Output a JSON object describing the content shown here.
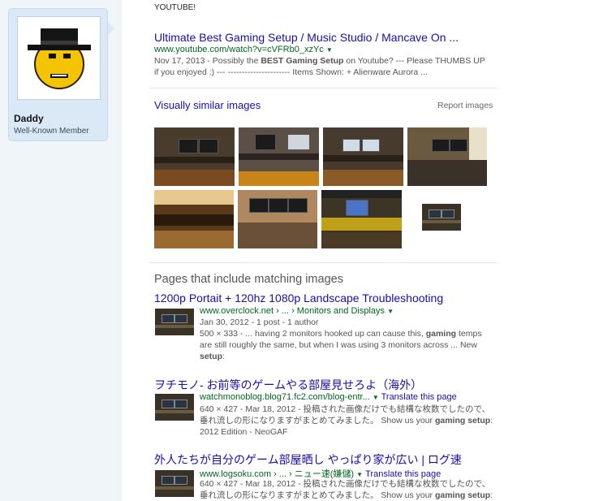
{
  "forum_user": {
    "name": "Daddy",
    "title": "Well-Known Member",
    "avatar": "smiley-fedora-avatar"
  },
  "results": {
    "clipped_top": "YOUTUBE!",
    "first": {
      "title": "Ultimate Best Gaming Setup / Music Studio / Mancave On ...",
      "url": "www.youtube.com/watch?v=cVFRb0_xzYc",
      "date": "Nov 17, 2013",
      "snippet_l1_a": " - Possibly the ",
      "snippet_l1_b": "BEST Gaming Setup",
      "snippet_l1_c": " on Youtube? --- Please THUMBS UP",
      "snippet_l2": "if you enjoyed :) --- ---------------------- Items Shown: + Alienware Aurora ..."
    },
    "similar": {
      "title": "Visually similar images",
      "report": "Report images"
    },
    "pages_title": "Pages that include matching images",
    "pages": [
      {
        "title": "1200p Portait + 120hz 1080p Landscape Troubleshooting",
        "url": "www.overclock.net › ... › Monitors and Displays",
        "translate": "",
        "meta": "Jan 30, 2012 - 1 post - 1 author",
        "l1": "500 × 333 - ... having 2 monitors hooked up can cause this, ",
        "l1b": "gaming",
        "l1c": " temps",
        "l2": "are still roughly the same, but when I was using 3 monitors across ... New",
        "l3": "setup",
        "l3c": ":"
      },
      {
        "title": "ヲチモノ- お前等のゲームやる部屋見せろよ（海外）",
        "url": "watchmonoblog.blog71.fc2.com/blog-entr...",
        "translate": "Translate this page",
        "meta": "640 × 427 - Mar 18, 2012 - 投稿された画像だけでも結構な枚数でしたので、",
        "l1": "垂れ流しの形になりますがまとめてみました。 Show us your ",
        "l1b": "gaming setup",
        "l1c": ":",
        "l2": "2012 Edition - NeoGAF",
        "l3": "",
        "l3c": ""
      },
      {
        "title": "外人たちが自分のゲーム部屋晒し やっぱり家が広い | ログ速",
        "url": "www.logsoku.com › ... › ニュー速(嫌儲)",
        "translate": "Translate this page",
        "meta": "640 × 427 - Mar 18, 2012 - 投稿された画像だけでも結構な枚数でしたので、",
        "l1": "垂れ流しの形になりますがまとめてみました。 Show us your ",
        "l1b": "gaming setup",
        "l1c": ":",
        "l2": "",
        "l3": "",
        "l3c": ""
      }
    ]
  },
  "colors": {
    "link": "#1a0dab",
    "url_green": "#006621",
    "snippet": "#545454",
    "panel_bg": "#dbe9f7"
  }
}
